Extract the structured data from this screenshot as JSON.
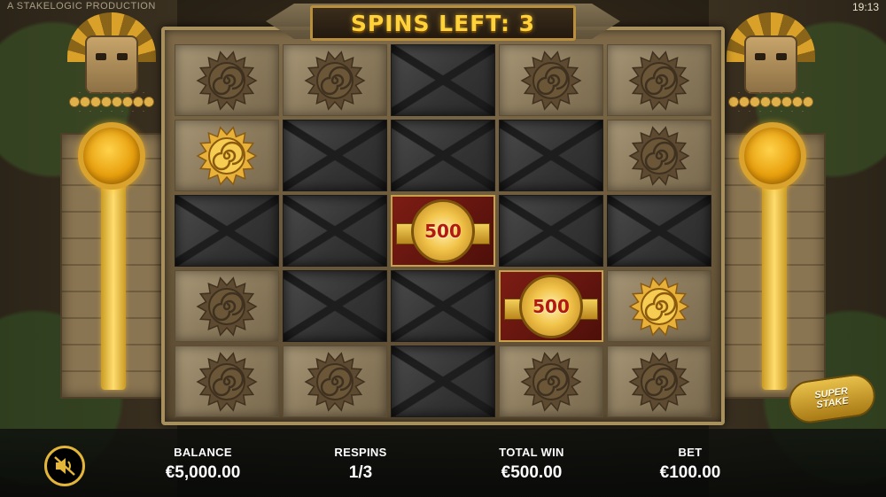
{
  "credit": "A STAKELOGIC PRODUCTION",
  "clock": "19:13",
  "banner": {
    "spins_left": "SPINS LEFT: 3"
  },
  "grid": {
    "rows": [
      [
        {
          "type": "stone",
          "symbol": "sun-dim"
        },
        {
          "type": "stone",
          "symbol": "sun-dim"
        },
        {
          "type": "blank"
        },
        {
          "type": "stone",
          "symbol": "sun-dim"
        },
        {
          "type": "stone",
          "symbol": "sun-dim"
        }
      ],
      [
        {
          "type": "stone",
          "symbol": "sun-gold"
        },
        {
          "type": "blank"
        },
        {
          "type": "blank"
        },
        {
          "type": "blank"
        },
        {
          "type": "stone",
          "symbol": "sun-dim"
        }
      ],
      [
        {
          "type": "blank"
        },
        {
          "type": "blank"
        },
        {
          "type": "coin",
          "value": "500"
        },
        {
          "type": "blank"
        },
        {
          "type": "blank"
        }
      ],
      [
        {
          "type": "stone",
          "symbol": "sun-dim"
        },
        {
          "type": "blank"
        },
        {
          "type": "blank"
        },
        {
          "type": "coin",
          "value": "500"
        },
        {
          "type": "stone",
          "symbol": "sun-gold"
        }
      ],
      [
        {
          "type": "stone",
          "symbol": "sun-dim"
        },
        {
          "type": "stone",
          "symbol": "sun-dim"
        },
        {
          "type": "blank"
        },
        {
          "type": "stone",
          "symbol": "sun-dim"
        },
        {
          "type": "stone",
          "symbol": "sun-dim"
        }
      ]
    ]
  },
  "brand": {
    "text": "SUPER\nSTAKE"
  },
  "footer": {
    "sound_icon": "speaker-muted-icon",
    "balance_label": "BALANCE",
    "balance_value": "€5,000.00",
    "respins_label": "RESPINS",
    "respins_value": "1/3",
    "total_win_label": "TOTAL WIN",
    "total_win_value": "€500.00",
    "bet_label": "BET",
    "bet_value": "€100.00"
  },
  "colors": {
    "gold": "#ffd23a",
    "coin_red": "#7d1d14",
    "bar_bg": "#0c0e0c"
  }
}
